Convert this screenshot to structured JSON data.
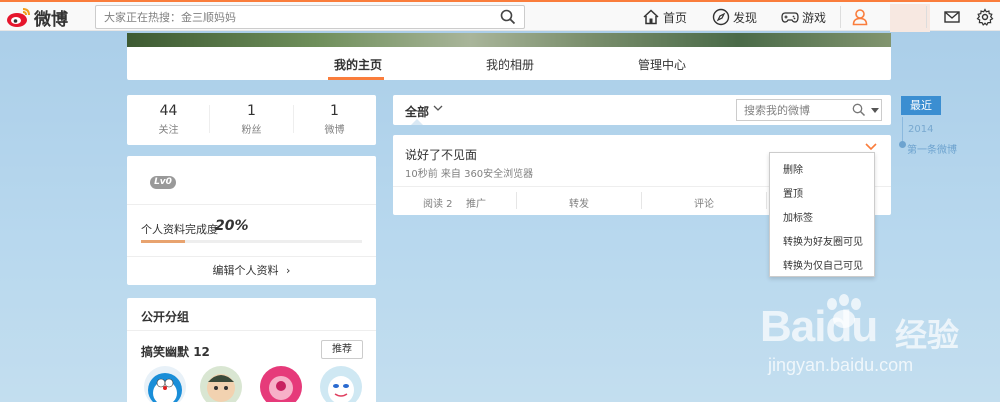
{
  "header": {
    "logo_text": "微博",
    "search_placeholder": "大家正在热搜：金三顺妈妈",
    "nav": [
      {
        "label": "首页",
        "icon": "home-icon"
      },
      {
        "label": "发现",
        "icon": "discover-icon"
      },
      {
        "label": "游戏",
        "icon": "gamepad-icon"
      }
    ],
    "icons": [
      "user-icon",
      "mail-icon",
      "gear-icon"
    ],
    "accent_color": "#fa7d3c"
  },
  "profile_tabs": [
    {
      "label": "我的主页",
      "active": true
    },
    {
      "label": "我的相册",
      "active": false
    },
    {
      "label": "管理中心",
      "active": false
    }
  ],
  "stats": [
    {
      "num": "44",
      "label": "关注"
    },
    {
      "num": "1",
      "label": "粉丝"
    },
    {
      "num": "1",
      "label": "微博"
    }
  ],
  "level": {
    "badge": "Lv0",
    "completion_label": "个人资料完成度",
    "completion_pct": "20%",
    "completion_value": 0.2,
    "edit_label": "编辑个人资料"
  },
  "groups": {
    "title": "公开分组",
    "name": "搞笑幽默",
    "count": "12",
    "recommend_label": "推荐"
  },
  "feed": {
    "filter_label": "全部",
    "search_placeholder": "搜索我的微博",
    "post": {
      "text": "说好了不见面",
      "meta": "10秒前 来自 360安全浏览器",
      "reads": "阅读 2",
      "promote": "推广",
      "repost": "转发",
      "comment": "评论"
    }
  },
  "dropdown_menu": [
    "删除",
    "置顶",
    "加标签",
    "转换为好友圈可见",
    "转换为仅自己可见"
  ],
  "timeline": {
    "recent": "最近",
    "year": "2014",
    "first": "第一条微博"
  },
  "watermark": {
    "brand": "Baidu",
    "brand_cn": "经验",
    "url": "jingyan.baidu.com"
  }
}
